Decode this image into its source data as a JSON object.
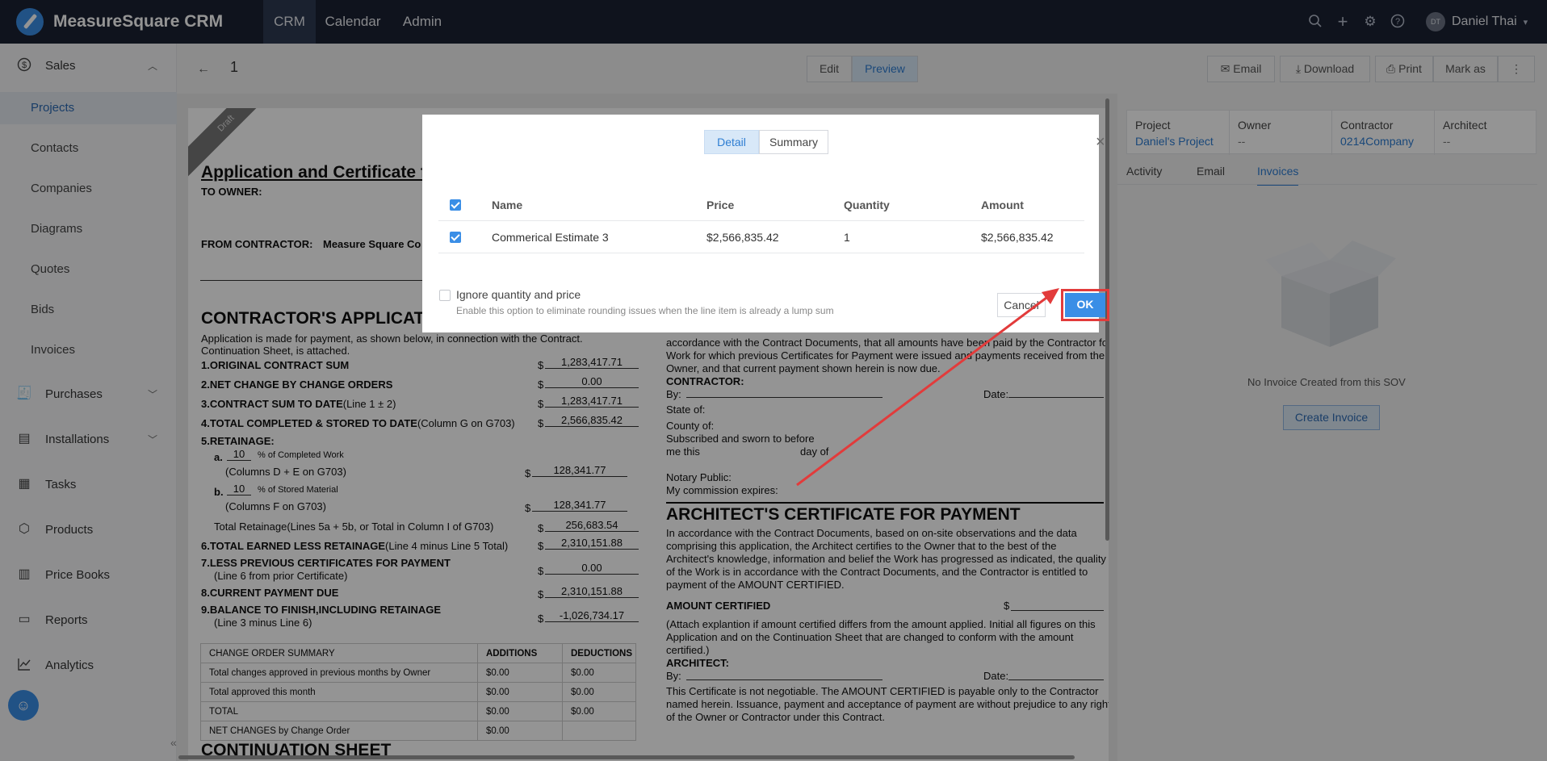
{
  "app": {
    "title": "MeasureSquare CRM"
  },
  "nav": {
    "tabs": [
      {
        "label": "CRM"
      },
      {
        "label": "Calendar"
      },
      {
        "label": "Admin"
      }
    ]
  },
  "header_icons": [
    "search-icon",
    "plus-icon",
    "gear-icon",
    "help-icon"
  ],
  "user": {
    "initials": "DT",
    "name": "Daniel Thai"
  },
  "sidebar": {
    "sales": {
      "label": "Sales",
      "items": [
        "Projects",
        "Contacts",
        "Companies",
        "Diagrams",
        "Quotes",
        "Bids",
        "Invoices"
      ]
    },
    "groups": [
      "Purchases",
      "Installations",
      "Tasks",
      "Products",
      "Price Books",
      "Reports",
      "Analytics"
    ]
  },
  "page": {
    "number": "1",
    "edit_label": "Edit",
    "preview_label": "Preview",
    "email_label": "Email",
    "download_label": "Download",
    "print_label": "Print",
    "markas_label": "Mark as"
  },
  "doc": {
    "draft": "Draft",
    "title": "Application and Certificate f",
    "to_owner": "TO OWNER:",
    "from_contractor": "FROM CONTRACTOR:",
    "contractor_name": "Measure Square Co",
    "application_heading": "CONTRACTOR'S APPLICAT",
    "intro1": "Application is made for payment, as shown below, in connection with the Contract.",
    "intro2": "Continuation Sheet, is attached.",
    "lines": [
      {
        "label": "1.ORIGINAL CONTRACT SUM",
        "note": "",
        "value": "1,283,417.71"
      },
      {
        "label": "2.NET CHANGE BY CHANGE ORDERS",
        "note": "",
        "value": "0.00"
      },
      {
        "label": "3.CONTRACT SUM TO DATE",
        "note": "(Line 1 ± 2)",
        "value": "1,283,417.71"
      },
      {
        "label": "4.TOTAL COMPLETED & STORED TO DATE",
        "note": "(Column G on G703)",
        "value": "2,566,835.42"
      }
    ],
    "retainage_label": "5.RETAINAGE:",
    "ret_a": {
      "letter": "a.",
      "pct": "10",
      "text": "% of Completed Work",
      "cols": "(Columns D + E on G703)",
      "value": "128,341.77"
    },
    "ret_b": {
      "letter": "b.",
      "pct": "10",
      "text": "% of Stored Material",
      "cols": "(Columns F on G703)",
      "value": "128,341.77"
    },
    "total_ret": {
      "label": "Total Retainage(Lines 5a + 5b, or Total in Column I of G703)",
      "value": "256,683.54"
    },
    "line6": {
      "label": "6.TOTAL EARNED LESS RETAINAGE",
      "note": "(Line 4 minus Line 5 Total)",
      "value": "2,310,151.88"
    },
    "line7": {
      "label": "7.LESS PREVIOUS CERTIFICATES FOR PAYMENT",
      "note": "(Line 6 from prior Certificate)",
      "value": "0.00"
    },
    "line8": {
      "label": "8.CURRENT PAYMENT DUE",
      "value": "2,310,151.88"
    },
    "line9": {
      "label": "9.BALANCE TO FINISH,INCLUDING RETAINAGE",
      "note": "(Line 3 minus Line 6)",
      "value": "-1,026,734.17"
    },
    "dollar": "$",
    "co_table": {
      "headers": [
        "CHANGE ORDER SUMMARY",
        "ADDITIONS",
        "DEDUCTIONS"
      ],
      "rows": [
        [
          "Total changes approved in previous months by Owner",
          "$0.00",
          "$0.00"
        ],
        [
          "Total approved this month",
          "$0.00",
          "$0.00"
        ],
        [
          "TOTAL",
          "$0.00",
          "$0.00"
        ],
        [
          "NET CHANGES by Change Order",
          "$0.00",
          ""
        ]
      ]
    },
    "continuation": "CONTINUATION SHEET",
    "right": {
      "p1": "accordance with the Contract Documents, that all amounts have been paid by the Contractor for",
      "p2": "Work for which previous Certificates for Payment were issued and payments received from the",
      "p3": "Owner, and that current payment shown herein is now due.",
      "contractor": "CONTRACTOR:",
      "by": "By:",
      "date": "Date:",
      "state": "State of:",
      "county": "County of:",
      "subscribed": "Subscribed and sworn to before",
      "methis": "me this",
      "dayof": "day of",
      "notary": "Notary Public:",
      "commission": "My commission expires:",
      "arch_heading": "ARCHITECT'S CERTIFICATE FOR PAYMENT",
      "a1": "In accordance with the Contract Documents, based on on-site observations and the data",
      "a2": "comprising this application, the Architect certifies to the Owner that to the best of the",
      "a3": "Architect's knowledge, information and belief the Work has progressed as indicated, the quality",
      "a4": "of the Work is in accordance with the Contract Documents, and the Contractor is entitled to",
      "a5": "payment of the AMOUNT CERTIFIED.",
      "amount_certified": "AMOUNT CERTIFIED",
      "att1": "(Attach explantion if amount certified differs from the amount applied. Initial all figures on this",
      "att2": "Application and on the Continuation Sheet that are changed to conform with the amount",
      "att3": "certified.)",
      "architect": "ARCHITECT:",
      "n1": "This Certificate is not negotiable. The AMOUNT CERTIFIED is payable only to the Contractor",
      "n2": "named herein. Issuance, payment and acceptance of payment are without prejudice to any rights",
      "n3": "of the Owner or Contractor under this Contract."
    }
  },
  "panel": {
    "project_label": "Project",
    "project_value": "Daniel's Project",
    "owner_label": "Owner",
    "owner_value": "--",
    "contractor_label": "Contractor",
    "contractor_value": "0214Company",
    "architect_label": "Architect",
    "architect_value": "--",
    "tabs": [
      "Activity",
      "Email",
      "Invoices"
    ],
    "empty_text": "No Invoice Created from this SOV",
    "create_label": "Create Invoice"
  },
  "modal": {
    "detail_label": "Detail",
    "summary_label": "Summary",
    "headers": [
      "Name",
      "Price",
      "Quantity",
      "Amount"
    ],
    "row": {
      "name": "Commerical Estimate 3",
      "price": "$2,566,835.42",
      "quantity": "1",
      "amount": "$2,566,835.42"
    },
    "ignore_label": "Ignore quantity and price",
    "ignore_help": "Enable this option to eliminate rounding issues when the line item is already a lump sum",
    "cancel_label": "Cancel",
    "ok_label": "OK"
  },
  "colors": {
    "topbar": "#1b2233",
    "accent": "#3a8ee6",
    "annotation": "#e23b3b"
  }
}
